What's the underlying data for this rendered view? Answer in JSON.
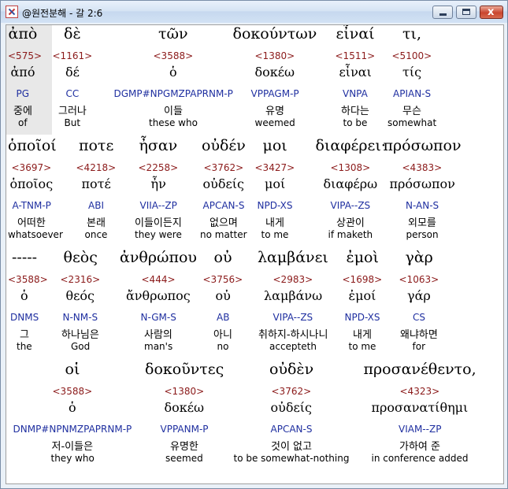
{
  "window": {
    "title": "@원전분해 - 갈 2:6",
    "min_label": "",
    "max_label": "",
    "close_label": "x"
  },
  "rows": [
    {
      "words": [
        {
          "greek": "ἀπὸ",
          "strong": "<575>",
          "lemma": "ἀπό",
          "parse": "PG",
          "korean": "중에",
          "english": "of"
        },
        {
          "greek": "δὲ",
          "strong": "<1161>",
          "lemma": "δέ",
          "parse": "CC",
          "korean": "그러나",
          "english": "But"
        },
        {
          "greek": "τῶν",
          "strong": "<3588>",
          "lemma": "ὁ",
          "parse": "DGMP#NPGMZPAPRNM-P",
          "korean": "이들",
          "english": "these who"
        },
        {
          "greek": "δοκούντων",
          "strong": "<1380>",
          "lemma": "δοκέω",
          "parse": "VPPAGM-P",
          "korean": "유명",
          "english": "weemed"
        },
        {
          "greek": "εἶναί",
          "strong": "<1511>",
          "lemma": "εἶναι",
          "parse": "VNPA",
          "korean": "하다는",
          "english": "to be"
        },
        {
          "greek": "τι,",
          "strong": "<5100>",
          "lemma": "τίς",
          "parse": "APIAN-S",
          "korean": "무슨",
          "english": "somewhat"
        }
      ]
    },
    {
      "words": [
        {
          "greek": "ὁποῖοί",
          "strong": "<3697>",
          "lemma": "ὁποῖος",
          "parse": "A-TNM-P",
          "korean": "어떠한",
          "english": "whatsoever"
        },
        {
          "greek": "ποτε",
          "strong": "<4218>",
          "lemma": "ποτέ",
          "parse": "ABI",
          "korean": "본래",
          "english": "once"
        },
        {
          "greek": "ἦσαν",
          "strong": "<2258>",
          "lemma": "ἦν",
          "parse": "VIIA--ZP",
          "korean": "이들이든지",
          "english": "they were"
        },
        {
          "greek": "οὐδέν",
          "strong": "<3762>",
          "lemma": "οὐδείς",
          "parse": "APCAN-S",
          "korean": "없으며",
          "english": "no matter"
        },
        {
          "greek": "μοι",
          "strong": "<3427>",
          "lemma": "μοί",
          "parse": "NPD-XS",
          "korean": "내게",
          "english": "to me"
        },
        {
          "greek": "διαφέρει·",
          "strong": "<1308>",
          "lemma": "διαφέρω",
          "parse": "VIPA--ZS",
          "korean": "상관이",
          "english": "if maketh"
        },
        {
          "greek": "πρόσωπον",
          "strong": "<4383>",
          "lemma": "πρόσωπον",
          "parse": "N-AN-S",
          "korean": "외모를",
          "english": "person"
        }
      ]
    },
    {
      "words": [
        {
          "greek": "-----",
          "strong": "<3588>",
          "lemma": "ὁ",
          "parse": "DNMS",
          "korean": "그",
          "english": "the"
        },
        {
          "greek": "θεὸς",
          "strong": "<2316>",
          "lemma": "θεός",
          "parse": "N-NM-S",
          "korean": "하나님은",
          "english": "God"
        },
        {
          "greek": "ἀνθρώπου",
          "strong": "<444>",
          "lemma": "ἄνθρωπος",
          "parse": "N-GM-S",
          "korean": "사람의",
          "english": "man's"
        },
        {
          "greek": "οὐ",
          "strong": "<3756>",
          "lemma": "οὐ",
          "parse": "AB",
          "korean": "아니",
          "english": "no"
        },
        {
          "greek": "λαμβάνει",
          "strong": "<2983>",
          "lemma": "λαμβάνω",
          "parse": "VIPA--ZS",
          "korean": "취하지-하시나니",
          "english": "accepteth"
        },
        {
          "greek": "ἐμοὶ",
          "strong": "<1698>",
          "lemma": "ἐμοί",
          "parse": "NPD-XS",
          "korean": "내게",
          "english": "to me"
        },
        {
          "greek": "γὰρ",
          "strong": "<1063>",
          "lemma": "γάρ",
          "parse": "CS",
          "korean": "왜냐하면",
          "english": "for"
        }
      ]
    },
    {
      "words": [
        {
          "greek": "οἱ",
          "strong": "<3588>",
          "lemma": "ὁ",
          "parse": "DNMP#NPNMZPAPRNM-P",
          "korean": "저-이들은",
          "english": "they who"
        },
        {
          "greek": "δοκοῦντες",
          "strong": "<1380>",
          "lemma": "δοκέω",
          "parse": "VPPANM-P",
          "korean": "유명한",
          "english": "seemed"
        },
        {
          "greek": "οὐδὲν",
          "strong": "<3762>",
          "lemma": "οὐδείς",
          "parse": "APCAN-S",
          "korean": "것이 없고",
          "english": "to be somewhat-nothing"
        },
        {
          "greek": "προσανέθεντο,",
          "strong": "<4323>",
          "lemma": "προσανατίθημι",
          "parse": "VIAM--ZP",
          "korean": "가하여 준",
          "english": "in conference added"
        }
      ]
    }
  ]
}
